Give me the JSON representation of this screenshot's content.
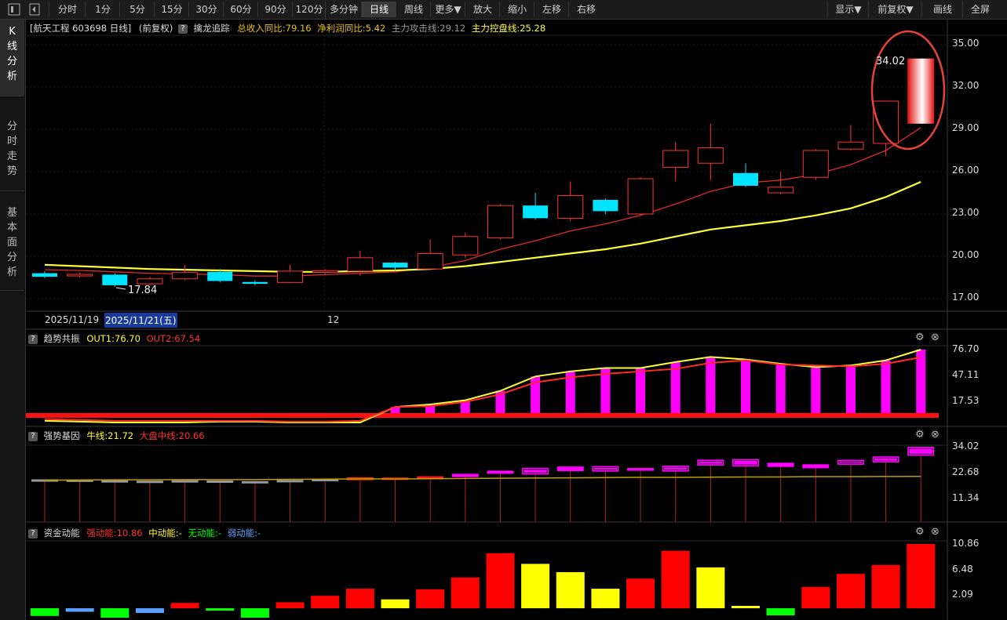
{
  "toolbar": {
    "items": [
      "分时",
      "1分",
      "5分",
      "15分",
      "30分",
      "60分",
      "90分",
      "120分",
      "多分钟",
      "日线",
      "周线",
      "更多▼",
      "放大",
      "缩小",
      "左移",
      "右移"
    ],
    "active": "日线",
    "right_items": [
      "显示▼",
      "前复权▼",
      "画线",
      "全屏"
    ]
  },
  "leftnav": {
    "tabs": [
      {
        "label": "K线分析"
      },
      {
        "label": "分时走势"
      },
      {
        "label": "基本面分析"
      }
    ]
  },
  "kline_header": {
    "title": "[航天工程 603698 日线]",
    "adjust": "(前复权)",
    "indicator": "擒龙追踪",
    "revenue_label": "总收入同比:79.16",
    "profit_label": "净利润同比:5.42",
    "attack_label": "主力攻击线:29.12",
    "control_label": "主力控盘线:25.28",
    "colors": {
      "revenue": "#e8c01a",
      "profit": "#e8c01a",
      "attack": "#9a9a9a",
      "control": "#ffff33"
    }
  },
  "kline": {
    "y_ticks": [
      "35.00",
      "32.00",
      "29.00",
      "26.00",
      "23.00",
      "20.00",
      "17.00"
    ],
    "high_label": "34.02",
    "low_label": "17.84",
    "date_left": "2025/11/19",
    "date_selected": "2025/11/21(五)",
    "month_label": "12",
    "ylim": [
      16.0,
      36.0
    ]
  },
  "chart_data": [
    {
      "type": "candlestick",
      "title": "航天工程 603698 日线",
      "ylim": [
        16.0,
        36.0
      ],
      "candles": [
        {
          "open": 18.8,
          "close": 18.55,
          "high": 18.95,
          "low": 18.45,
          "dir": "down"
        },
        {
          "open": 18.62,
          "close": 18.72,
          "high": 18.85,
          "low": 18.5,
          "dir": "up"
        },
        {
          "open": 18.7,
          "close": 17.95,
          "high": 18.8,
          "low": 17.84,
          "dir": "down"
        },
        {
          "open": 18.05,
          "close": 18.4,
          "high": 18.55,
          "low": 17.95,
          "dir": "up"
        },
        {
          "open": 18.4,
          "close": 18.85,
          "high": 19.4,
          "low": 18.3,
          "dir": "up"
        },
        {
          "open": 18.9,
          "close": 18.25,
          "high": 19.1,
          "low": 18.15,
          "dir": "down"
        },
        {
          "open": 18.18,
          "close": 18.05,
          "high": 18.3,
          "low": 17.95,
          "dir": "down"
        },
        {
          "open": 18.15,
          "close": 18.95,
          "high": 19.4,
          "low": 18.1,
          "dir": "up"
        },
        {
          "open": 18.95,
          "close": 18.98,
          "high": 19.1,
          "low": 18.7,
          "dir": "up"
        },
        {
          "open": 18.95,
          "close": 19.9,
          "high": 20.4,
          "low": 18.6,
          "dir": "up"
        },
        {
          "open": 19.55,
          "close": 19.2,
          "high": 19.6,
          "low": 18.95,
          "dir": "down"
        },
        {
          "open": 19.1,
          "close": 20.2,
          "high": 21.2,
          "low": 19.1,
          "dir": "up"
        },
        {
          "open": 20.1,
          "close": 21.4,
          "high": 21.7,
          "low": 19.9,
          "dir": "up"
        },
        {
          "open": 21.3,
          "close": 23.6,
          "high": 23.7,
          "low": 21.2,
          "dir": "up"
        },
        {
          "open": 23.6,
          "close": 22.7,
          "high": 24.5,
          "low": 22.6,
          "dir": "down"
        },
        {
          "open": 22.7,
          "close": 24.3,
          "high": 25.3,
          "low": 22.5,
          "dir": "up"
        },
        {
          "open": 24.0,
          "close": 23.2,
          "high": 24.1,
          "low": 23.0,
          "dir": "down"
        },
        {
          "open": 23.0,
          "close": 25.5,
          "high": 25.6,
          "low": 22.9,
          "dir": "up"
        },
        {
          "open": 26.3,
          "close": 27.5,
          "high": 28.1,
          "low": 25.3,
          "dir": "up"
        },
        {
          "open": 26.6,
          "close": 27.7,
          "high": 29.4,
          "low": 25.4,
          "dir": "up"
        },
        {
          "open": 25.9,
          "close": 25.0,
          "high": 26.6,
          "low": 24.9,
          "dir": "down"
        },
        {
          "open": 24.5,
          "close": 24.9,
          "high": 26.0,
          "low": 24.4,
          "dir": "up"
        },
        {
          "open": 25.6,
          "close": 27.5,
          "high": 27.6,
          "low": 25.4,
          "dir": "up"
        },
        {
          "open": 27.6,
          "close": 28.1,
          "high": 29.3,
          "low": 27.5,
          "dir": "up"
        },
        {
          "open": 28.0,
          "close": 31.0,
          "high": 31.0,
          "low": 27.1,
          "dir": "up"
        },
        {
          "open": 29.4,
          "close": 34.02,
          "high": 34.02,
          "low": 29.4,
          "dir": "up"
        }
      ],
      "series": [
        {
          "name": "主力攻击线",
          "color": "#e02a2a",
          "values": [
            19.05,
            19.0,
            18.9,
            18.8,
            18.75,
            18.7,
            18.6,
            18.6,
            18.7,
            18.8,
            18.9,
            19.2,
            19.7,
            20.5,
            21.1,
            21.8,
            22.3,
            22.9,
            23.7,
            24.6,
            25.2,
            25.4,
            25.8,
            26.5,
            27.5,
            29.12
          ]
        },
        {
          "name": "主力控盘线",
          "color": "#ffff33",
          "values": [
            19.4,
            19.3,
            19.2,
            19.1,
            19.05,
            19.0,
            18.95,
            18.9,
            18.9,
            18.95,
            19.0,
            19.1,
            19.3,
            19.6,
            19.9,
            20.2,
            20.5,
            20.9,
            21.4,
            21.9,
            22.2,
            22.5,
            22.9,
            23.4,
            24.2,
            25.28
          ]
        }
      ]
    },
    {
      "type": "bar",
      "title": "趋势共振",
      "ylim": [
        0,
        95
      ],
      "y_ticks": [
        "76.70",
        "47.11",
        "17.53"
      ],
      "series": [
        {
          "name": "OUT1",
          "values": [
            2,
            1,
            0,
            0,
            0,
            1,
            1,
            0,
            0,
            0,
            9,
            12,
            17,
            28,
            45,
            51,
            55,
            55,
            62,
            68,
            65,
            60,
            56,
            58,
            64,
            76.7
          ]
        },
        {
          "name": "OUT2",
          "values": [
            4,
            3,
            2,
            2,
            2,
            2,
            2,
            1,
            1,
            2,
            9,
            10,
            15,
            24,
            38,
            44,
            48,
            51,
            54,
            61,
            64,
            59,
            58,
            57,
            60,
            67.54
          ]
        }
      ],
      "threshold": 11.8
    },
    {
      "type": "bar",
      "title": "强势基因",
      "ylim": [
        0,
        40
      ],
      "y_ticks": [
        "34.02",
        "22.68",
        "11.34"
      ],
      "series": [
        {
          "name": "牛线",
          "values": [
            19.2,
            19.2,
            18.6,
            18.6,
            18.7,
            18.5,
            18.3,
            18.6,
            19.5,
            19.7,
            19.9,
            20.6,
            21.4,
            22.3,
            23.5,
            23.9,
            24.3,
            23.6,
            24.6,
            26.9,
            27.1,
            26.0,
            25.3,
            27.5,
            28.3,
            31.3
          ]
        },
        {
          "name": "大盘中线",
          "values": [
            18.9,
            19.0,
            19.1,
            19.1,
            19.2,
            19.2,
            19.2,
            19.3,
            19.4,
            19.5,
            19.5,
            19.6,
            19.7,
            19.8,
            19.9,
            20.0,
            20.1,
            20.2,
            20.2,
            20.3,
            20.4,
            20.4,
            20.5,
            20.5,
            20.6,
            20.66
          ]
        }
      ],
      "boxes": [
        {
          "o": 19.3,
          "c": 18.8,
          "k": "gray"
        },
        {
          "o": 19.2,
          "c": 19.0,
          "k": "gray"
        },
        {
          "o": 18.9,
          "c": 18.5,
          "k": "gray"
        },
        {
          "o": 18.7,
          "c": 18.4,
          "k": "gray"
        },
        {
          "o": 18.9,
          "c": 18.5,
          "k": "gray"
        },
        {
          "o": 18.8,
          "c": 18.3,
          "k": "gray"
        },
        {
          "o": 18.5,
          "c": 18.2,
          "k": "gray"
        },
        {
          "o": 19.0,
          "c": 18.3,
          "k": "gray"
        },
        {
          "o": 19.5,
          "c": 19.1,
          "k": "gray"
        },
        {
          "o": 20.2,
          "c": 18.9,
          "k": "red"
        },
        {
          "o": 20.1,
          "c": 19.2,
          "k": "red"
        },
        {
          "o": 20.7,
          "c": 19.3,
          "k": "red"
        },
        {
          "o": 21.8,
          "c": 20.3,
          "k": "mag"
        },
        {
          "o": 23.2,
          "c": 21.8,
          "k": "mag"
        },
        {
          "o": 24.5,
          "c": 21.5,
          "k": "mag"
        },
        {
          "o": 25.1,
          "c": 23.0,
          "k": "mag"
        },
        {
          "o": 25.3,
          "c": 22.8,
          "k": "mag"
        },
        {
          "o": 24.4,
          "c": 23.2,
          "k": "mag"
        },
        {
          "o": 25.5,
          "c": 22.8,
          "k": "mag"
        },
        {
          "o": 28.2,
          "c": 25.5,
          "k": "mag"
        },
        {
          "o": 28.5,
          "c": 25.1,
          "k": "mag"
        },
        {
          "o": 26.8,
          "c": 24.9,
          "k": "mag"
        },
        {
          "o": 26.1,
          "c": 24.3,
          "k": "mag"
        },
        {
          "o": 28.1,
          "c": 25.9,
          "k": "mag"
        },
        {
          "o": 29.7,
          "c": 26.9,
          "k": "mag"
        },
        {
          "o": 34.02,
          "c": 30.0,
          "k": "mag"
        }
      ]
    },
    {
      "type": "bar",
      "title": "资金动能",
      "ylim": [
        -3.5,
        12.0
      ],
      "y_ticks": [
        "10.86",
        "6.48",
        "2.09"
      ],
      "series": [
        {
          "name": "强动能",
          "values": [
            -1.3,
            -0.6,
            -1.6,
            -0.8,
            0.9,
            -0.4,
            -1.6,
            1.0,
            2.1,
            3.3,
            1.5,
            3.2,
            5.2,
            9.3,
            7.5,
            6.1,
            3.3,
            5.0,
            9.7,
            6.9,
            0.4,
            -1.2,
            3.6,
            5.8,
            7.3,
            10.86
          ]
        }
      ],
      "kinds": [
        "green",
        "blue",
        "green",
        "blue",
        "red",
        "green",
        "green",
        "red",
        "red",
        "red",
        "yellow",
        "red",
        "red",
        "red",
        "yellow",
        "yellow",
        "yellow",
        "red",
        "red",
        "yellow",
        "yellow",
        "green",
        "red",
        "red",
        "red",
        "red"
      ]
    }
  ],
  "panel2": {
    "name": "趋势共振",
    "out1": "OUT1:76.70",
    "out2": "OUT2:67.54"
  },
  "panel3": {
    "name": "强势基因",
    "bull": "牛线:21.72",
    "market": "大盘中线:20.66"
  },
  "panel4": {
    "name": "资金动能",
    "strong": "强动能:10.86",
    "mid": "中动能:-",
    "none": "无动能:-",
    "weak": "弱动能:-"
  },
  "colors": {
    "up": "#ff3232",
    "down": "#00e5ff",
    "ma_red": "#e02a2a",
    "ma_yellow": "#ffff33",
    "magenta": "#ff00ff",
    "yellow": "#ffff00",
    "red": "#ff0000",
    "green": "#00ff00",
    "blue": "#5aa0ff",
    "gray": "#9a9a9a",
    "circle": "#e8433a"
  }
}
